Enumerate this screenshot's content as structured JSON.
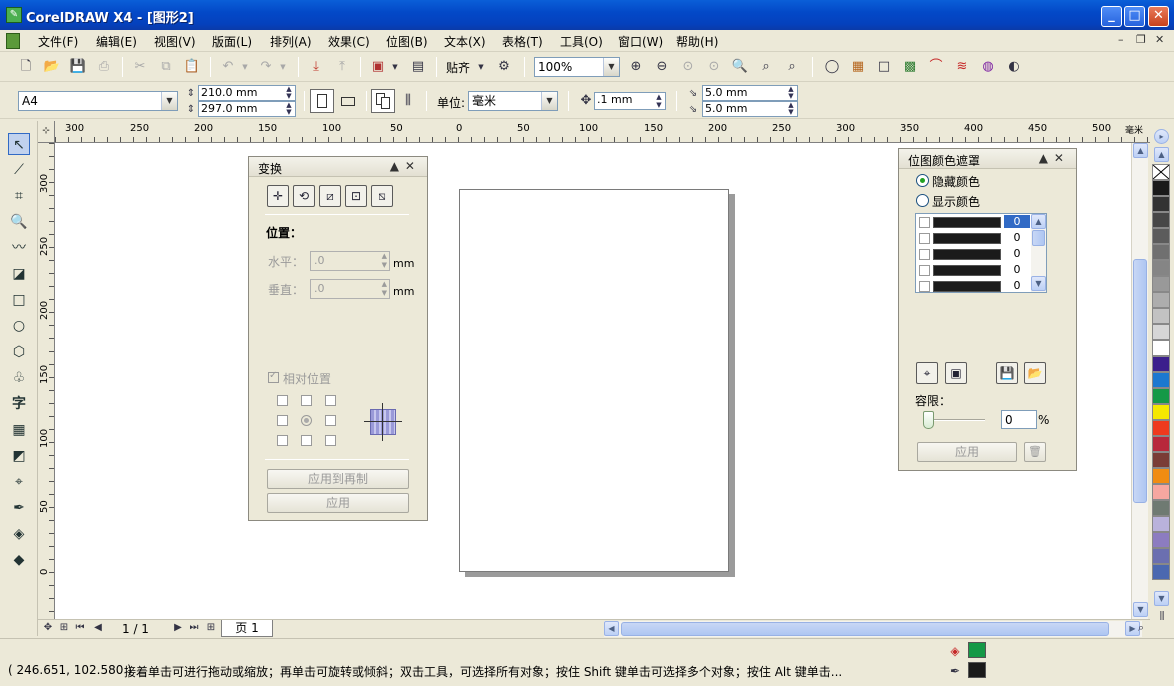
{
  "window": {
    "title": "CorelDRAW X4 - [图形2]",
    "app_icon_glyph": "✎",
    "minimize": "_",
    "maximize": "□",
    "close": "✕"
  },
  "menu": {
    "items": [
      "文件(F)",
      "编辑(E)",
      "视图(V)",
      "版面(L)",
      "排列(A)",
      "效果(C)",
      "位图(B)",
      "文本(X)",
      "表格(T)",
      "工具(O)",
      "窗口(W)",
      "帮助(H)"
    ],
    "mdi": {
      "minimize": "–",
      "restore": "❐",
      "close": "✕"
    }
  },
  "toolbar": {
    "snap_label": "贴齐",
    "zoom_value": "100%",
    "zoom_in": "⊕",
    "zoom_out": "⊖",
    "arrow": "▼",
    "icons": [
      "new-icon",
      "open-icon",
      "save-icon",
      "print-icon",
      "cut-icon",
      "copy-icon",
      "paste-icon",
      "undo-icon",
      "redo-icon",
      "import-icon",
      "export-icon",
      "application-launcher-icon",
      "welcome-screen-icon",
      "options-icon"
    ]
  },
  "property_bar": {
    "paper_size": "A4",
    "width": "210.0 mm",
    "height": "297.0 mm",
    "units_label": "单位:",
    "units_value": "毫米",
    "nudge": ".1 mm",
    "dup_x": "5.0 mm",
    "dup_y": "5.0 mm"
  },
  "ruler": {
    "h_ticks": [
      "300",
      "250",
      "200",
      "150",
      "100",
      "50",
      "0",
      "50",
      "100",
      "150",
      "200",
      "250",
      "300",
      "350",
      "400",
      "450",
      "500"
    ],
    "h_unit": "毫米",
    "v_ticks": [
      "300",
      "250",
      "200",
      "150",
      "100",
      "50",
      "0"
    ]
  },
  "transform_docker": {
    "title": "变换",
    "position_label": "位置：",
    "horizontal_label": "水平：",
    "horizontal_value": ".0",
    "vertical_label": "垂直：",
    "vertical_value": ".0",
    "unit": "mm",
    "relative_label": "相对位置",
    "apply_copy": "应用到再制",
    "apply": "应用"
  },
  "mask_docker": {
    "title": "位图颜色遮罩",
    "hide_colors": "隐藏颜色",
    "show_colors": "显示颜色",
    "rows": [
      {
        "value": "0"
      },
      {
        "value": "0"
      },
      {
        "value": "0"
      },
      {
        "value": "0"
      },
      {
        "value": "0"
      }
    ],
    "tolerance_label": "容限：",
    "tolerance_value": "0",
    "percent": "%",
    "apply": "应用"
  },
  "navigator": {
    "page_count": "1 / 1",
    "page_tab": "页 1"
  },
  "status": {
    "coords": "( 246.651, 102.580 )",
    "hint": "接着单击可进行拖动或缩放；再单击可旋转或倾斜；双击工具，可选择所有对象；按住 Shift 键单击可选择多个对象；按住 Alt 键单击...",
    "fill_color": "#159947",
    "outline_color": "#1a1a1a"
  },
  "tools": {
    "text_tool_glyph": "字"
  },
  "palette": {
    "colors": [
      "#1a1a1a",
      "#333333",
      "#474747",
      "#5c5c5c",
      "#707070",
      "#858585",
      "#999999",
      "#adadad",
      "#c2c2c2",
      "#d6d6d6",
      "#ffffff",
      "#3b1f8c",
      "#1b78d0",
      "#159947",
      "#f5e800",
      "#ee3a1e",
      "#b8283b",
      "#7a3c36",
      "#f08c12",
      "#f6a7a0",
      "#6f7a72",
      "#b9b2db",
      "#8c7cc0",
      "#6b6fb0",
      "#4b68b0"
    ]
  }
}
